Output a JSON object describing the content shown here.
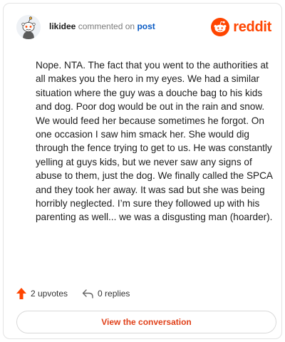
{
  "header": {
    "username": "likidee",
    "action": "commented on",
    "target": "post",
    "brand": "reddit"
  },
  "comment": {
    "text": "Nope. NTA. The fact that you went to the authorities at all makes you the hero in my eyes. We had a similar situation where the guy was a douche bag to his kids and dog. Poor dog would be out in the rain and snow. We would feed her because sometimes he forgot. On one occasion I saw him smack her. She would dig through the fence trying to get to us. He was constantly yelling at guys kids, but we never saw any signs of abuse to them, just the dog. We finally called the SPCA and they took her away. It was sad but she was being horribly neglected. I’m sure they followed up with his parenting as well... we was a disgusting man (hoarder)."
  },
  "actions": {
    "upvotes": "2 upvotes",
    "replies": "0 replies"
  },
  "cta": {
    "label": "View the conversation"
  },
  "colors": {
    "brand": "#ff4500",
    "link": "#0a5bc4",
    "upvote": "#ff4500",
    "cta_text": "#e0411a"
  },
  "icons": {
    "avatar": "snoo-avatar",
    "brand": "reddit-logo-icon",
    "upvote": "upvote-arrow-icon",
    "reply": "reply-arrow-icon"
  }
}
